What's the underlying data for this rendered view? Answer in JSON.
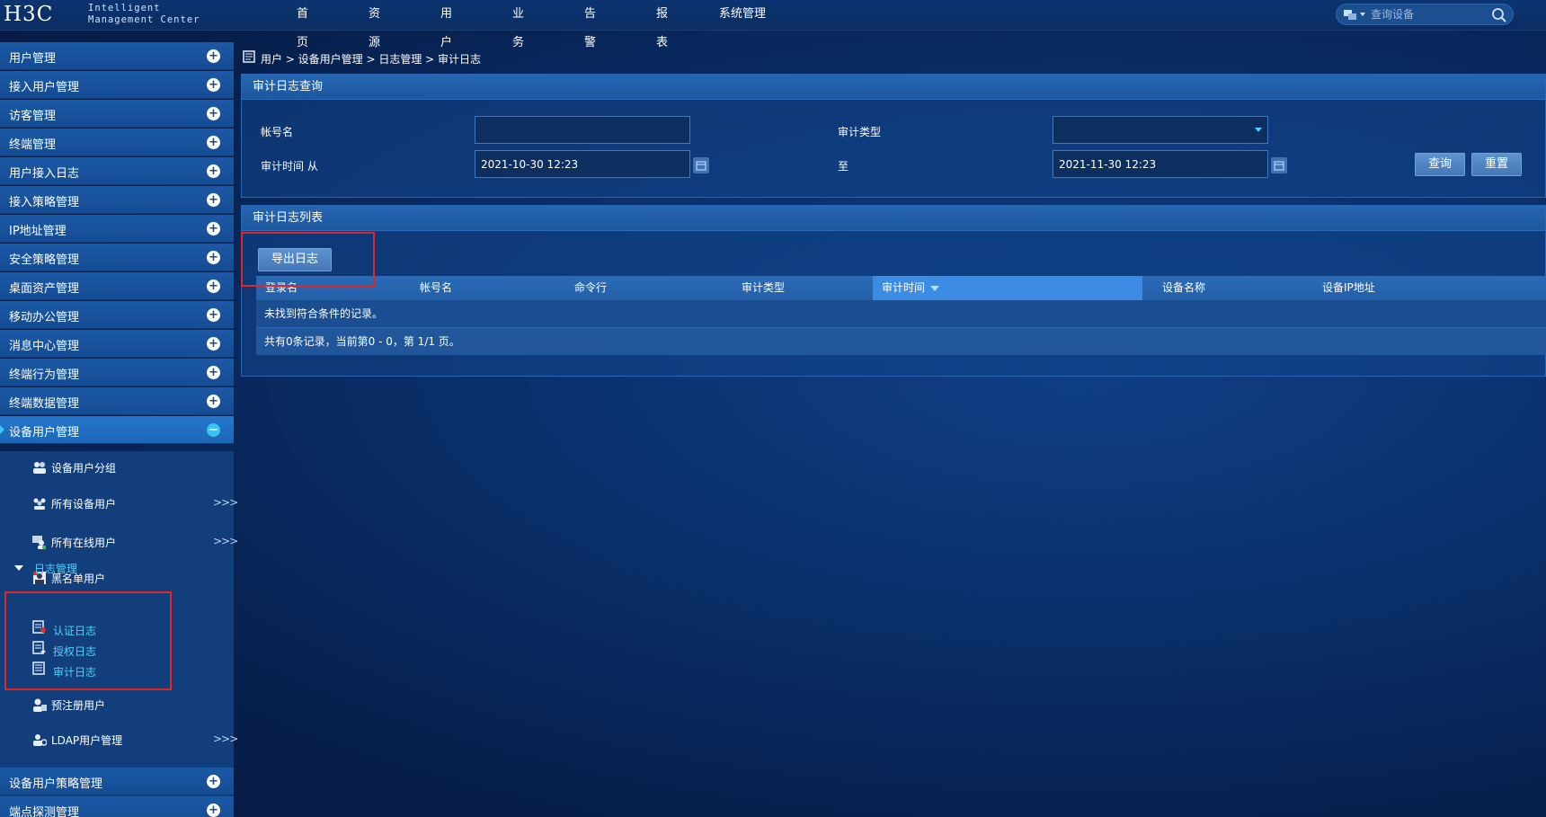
{
  "logo": {
    "brand": "H3C",
    "line1": "Intelligent",
    "line2": "Management Center"
  },
  "nav": {
    "items": [
      "首页",
      "资源",
      "用户",
      "业务",
      "告警",
      "报表",
      "系统管理"
    ]
  },
  "top_search": {
    "placeholder": "查询设备"
  },
  "sidebar": {
    "menu": [
      "用户管理",
      "接入用户管理",
      "访客管理",
      "终端管理",
      "用户接入日志",
      "接入策略管理",
      "IP地址管理",
      "安全策略管理",
      "桌面资产管理",
      "移动办公管理",
      "消息中心管理",
      "终端行为管理",
      "终端数据管理",
      "设备用户管理"
    ],
    "submenu": {
      "items": [
        "设备用户分组",
        "所有设备用户",
        "所有在线用户",
        "黑名单用户"
      ],
      "log_group": {
        "label": "日志管理",
        "items": [
          "认证日志",
          "授权日志",
          "审计日志"
        ]
      },
      "after": [
        "预注册用户",
        "LDAP用户管理"
      ],
      "chevron": ">>>"
    },
    "bottom_menu": [
      "设备用户策略管理",
      "端点探测管理"
    ]
  },
  "breadcrumb": {
    "text": "用户 > 设备用户管理 > 日志管理 > 审计日志"
  },
  "query_panel": {
    "title": "审计日志查询",
    "account_label": "帐号名",
    "account_value": "",
    "type_label": "审计类型",
    "type_value": "",
    "time_from_label": "审计时间 从",
    "time_from_value": "2021-10-30 12:23",
    "time_to_label": "至",
    "time_to_value": "2021-11-30 12:23",
    "query_button": "查询",
    "reset_button": "重置"
  },
  "list_panel": {
    "title": "审计日志列表",
    "export_button": "导出日志",
    "columns": [
      "登录名",
      "帐号名",
      "命令行",
      "审计类型",
      "审计时间",
      "设备名称",
      "设备IP地址"
    ],
    "sorted_column": "审计时间",
    "empty_message": "未找到符合条件的记录。",
    "footer": "共有0条记录，当前第0 - 0，第 1/1 页。"
  },
  "colors": {
    "accent": "#4fd0ff",
    "highlight": "#e0262b",
    "menu_bg": "#1b5aa7"
  }
}
